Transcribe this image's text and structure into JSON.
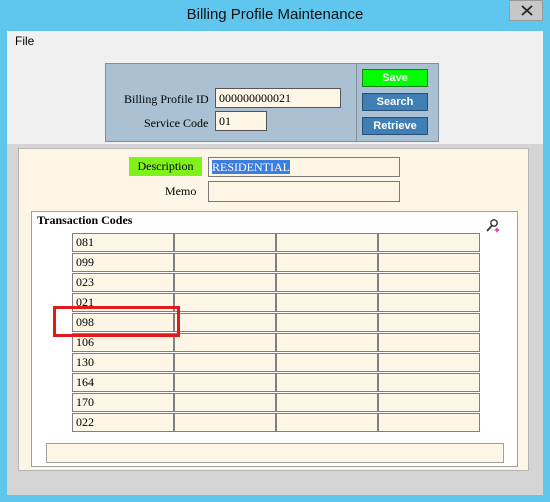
{
  "window": {
    "title": "Billing Profile Maintenance"
  },
  "menu": {
    "file": "File"
  },
  "key": {
    "billing_profile_id_label": "Billing Profile ID",
    "billing_profile_id_value": "000000000021",
    "service_code_label": "Service Code",
    "service_code_value": "01"
  },
  "buttons": {
    "save": "Save",
    "search": "Search",
    "retrieve": "Retrieve"
  },
  "details": {
    "description_label": "Description",
    "description_value": "RESIDENTIAL",
    "memo_label": "Memo",
    "memo_value": ""
  },
  "transaction_codes": {
    "title": "Transaction Codes",
    "codes": [
      [
        "081",
        "",
        "",
        ""
      ],
      [
        "099",
        "",
        "",
        ""
      ],
      [
        "023",
        "",
        "",
        ""
      ],
      [
        "021",
        "",
        "",
        ""
      ],
      [
        "098",
        "",
        "",
        ""
      ],
      [
        "106",
        "",
        "",
        ""
      ],
      [
        "130",
        "",
        "",
        ""
      ],
      [
        "164",
        "",
        "",
        ""
      ],
      [
        "170",
        "",
        "",
        ""
      ],
      [
        "022",
        "",
        "",
        ""
      ]
    ]
  },
  "icons": {
    "close": "close-icon",
    "zoom": "zoom-icon"
  },
  "colors": {
    "title_bar": "#5fc6ee",
    "save": "#00ff00",
    "action": "#3f7fb5",
    "description_label": "#7ff21a",
    "highlight": "#e01b1b"
  }
}
